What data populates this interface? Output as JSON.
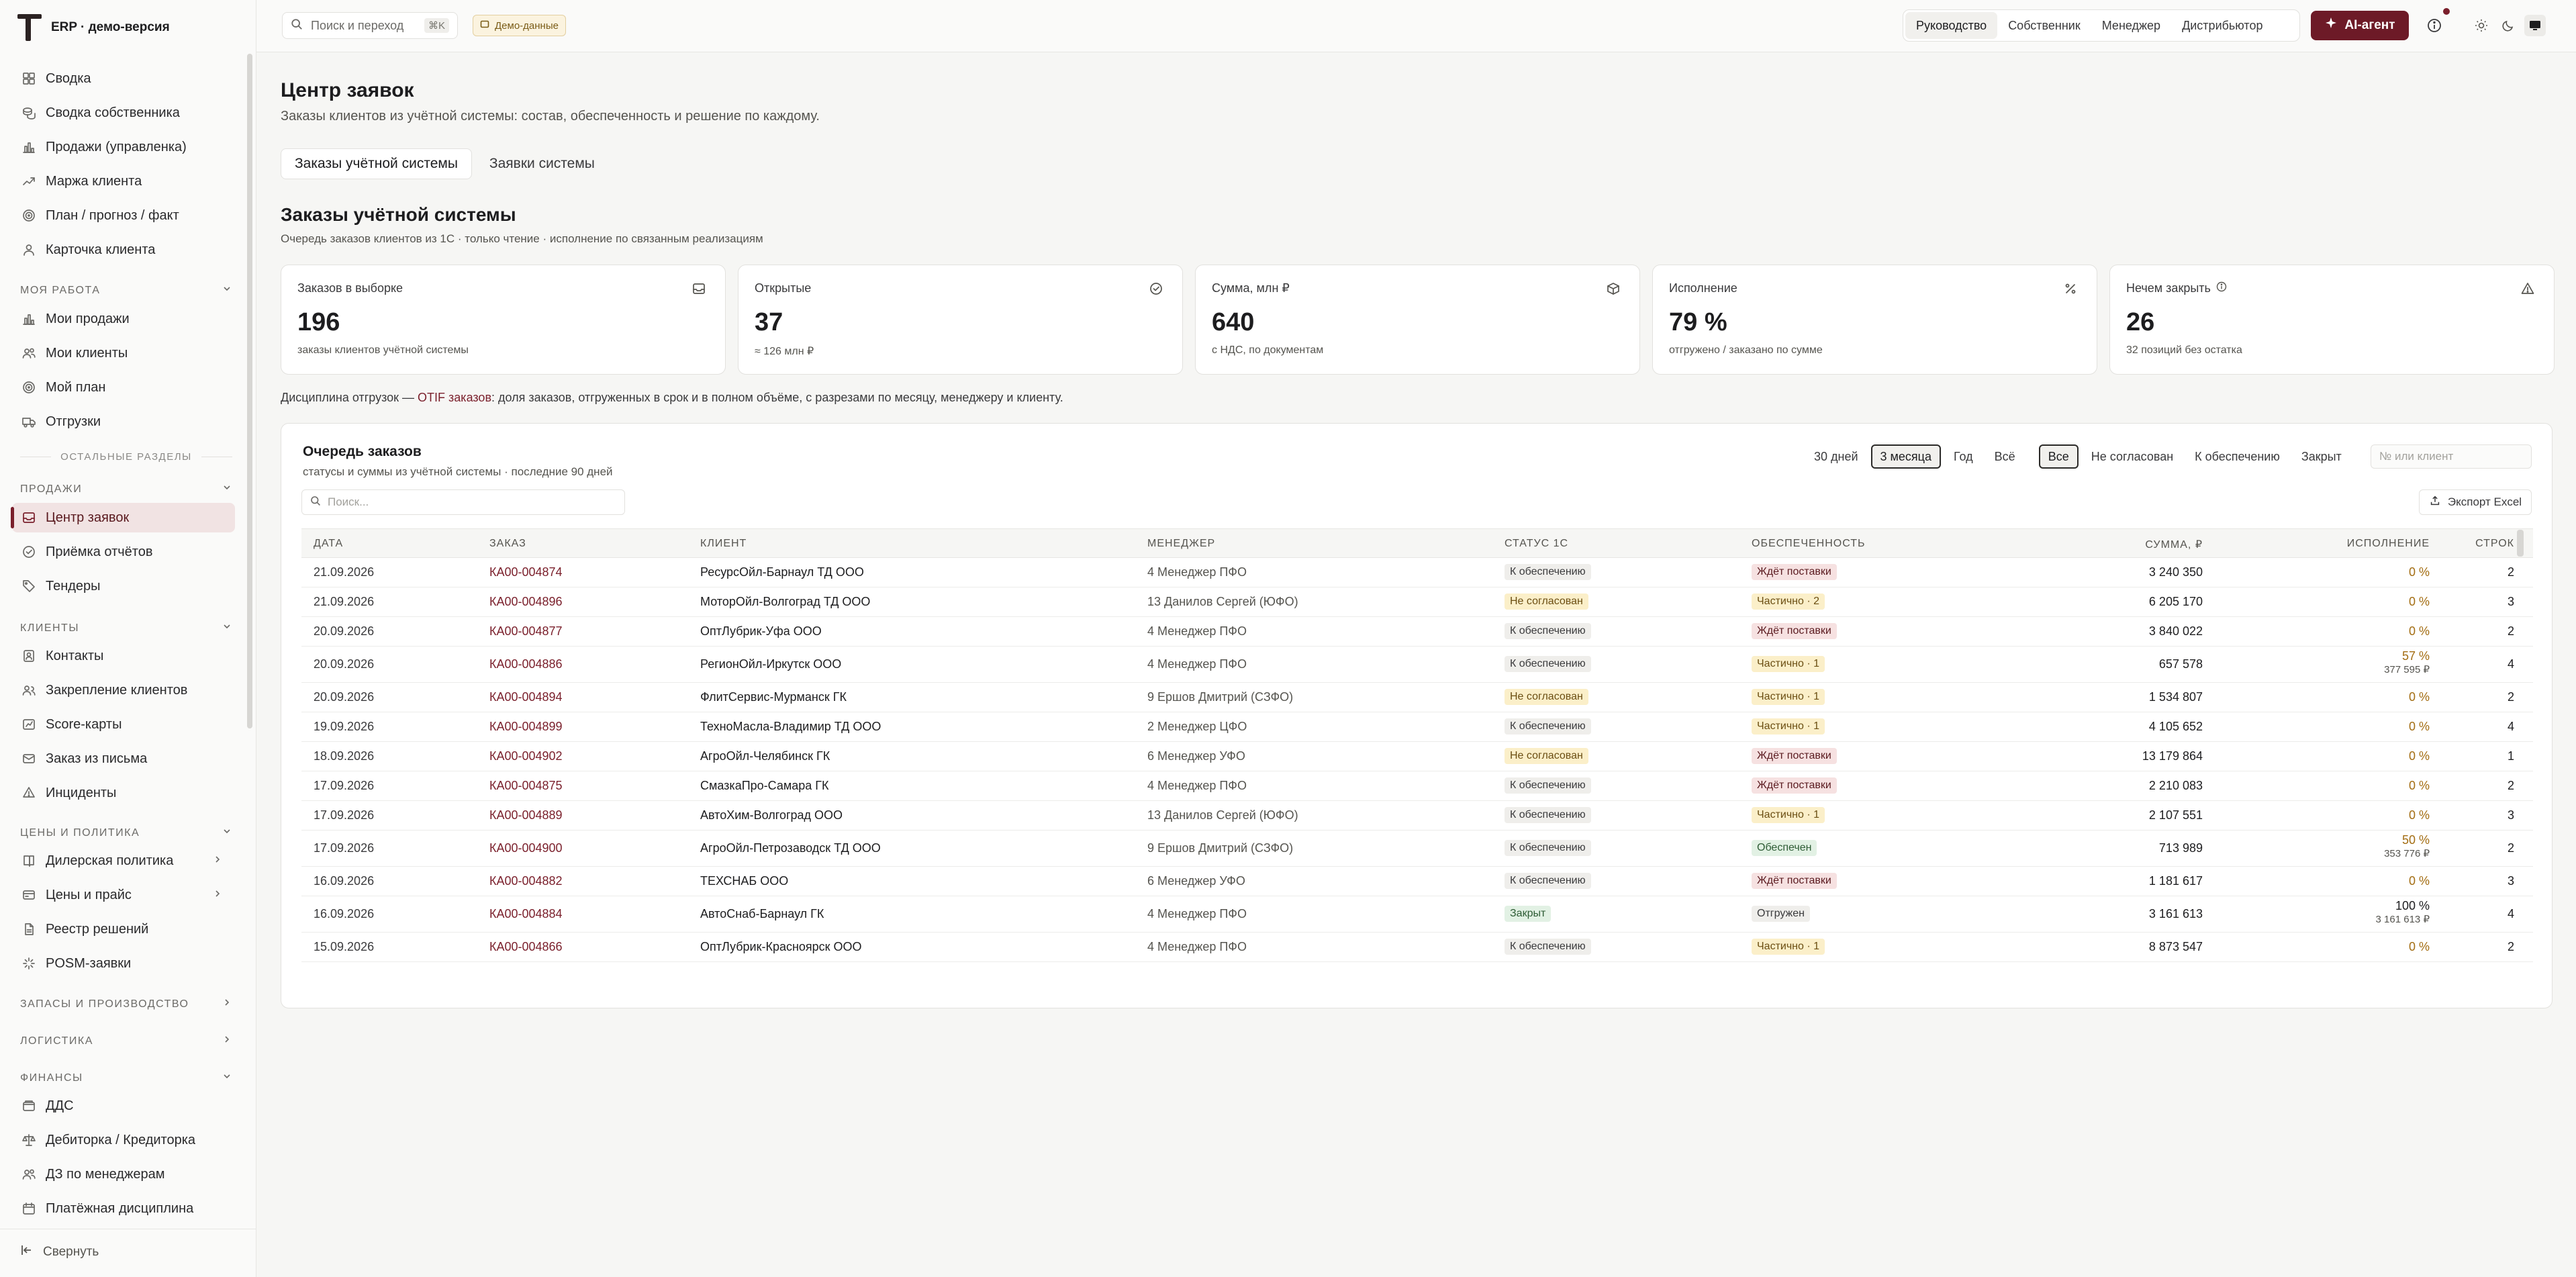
{
  "brand": {
    "name": "ERP · демо-версия"
  },
  "sidebar": {
    "top_items": [
      {
        "label": "Сводка",
        "icon": "grid-icon"
      },
      {
        "label": "Сводка собственника",
        "icon": "coins-icon"
      },
      {
        "label": "Продажи (управленка)",
        "icon": "bar-chart-icon"
      },
      {
        "label": "Маржа клиента",
        "icon": "trend-icon"
      },
      {
        "label": "План / прогноз / факт",
        "icon": "target-icon"
      },
      {
        "label": "Карточка клиента",
        "icon": "user-icon"
      }
    ],
    "section_my_work": "МОЯ РАБОТА",
    "my_work_items": [
      {
        "label": "Мои продажи",
        "icon": "bar-chart-icon"
      },
      {
        "label": "Мои клиенты",
        "icon": "users-icon"
      },
      {
        "label": "Мой план",
        "icon": "target-icon"
      },
      {
        "label": "Отгрузки",
        "icon": "truck-icon"
      }
    ],
    "other_sections": "ОСТАЛЬНЫЕ РАЗДЕЛЫ",
    "section_sales": "ПРОДАЖИ",
    "sales_items": [
      {
        "label": "Центр заявок",
        "icon": "inbox-icon"
      },
      {
        "label": "Приёмка отчётов",
        "icon": "check-circle-icon"
      },
      {
        "label": "Тендеры",
        "icon": "tag-icon"
      }
    ],
    "section_clients": "КЛИЕНТЫ",
    "clients_items": [
      {
        "label": "Контакты",
        "icon": "contacts-icon"
      },
      {
        "label": "Закрепление клиентов",
        "icon": "link-users-icon"
      },
      {
        "label": "Score-карты",
        "icon": "score-icon"
      },
      {
        "label": "Заказ из письма",
        "icon": "mail-icon"
      },
      {
        "label": "Инциденты",
        "icon": "incident-icon"
      }
    ],
    "section_prices": "ЦЕНЫ И ПОЛИТИКА",
    "prices_items": [
      {
        "label": "Дилерская политика",
        "icon": "book-icon"
      },
      {
        "label": "Цены и прайс",
        "icon": "price-icon"
      },
      {
        "label": "Реестр решений",
        "icon": "doc-icon"
      },
      {
        "label": "POSM-заявки",
        "icon": "sparkle-icon"
      }
    ],
    "section_stock": "ЗАПАСЫ И ПРОИЗВОДСТВО",
    "section_logistics": "ЛОГИСТИКА",
    "section_finance": "ФИНАНСЫ",
    "finance_items": [
      {
        "label": "ДДС",
        "icon": "wallet-icon"
      },
      {
        "label": "Дебиторка / Кредиторка",
        "icon": "scales-icon"
      },
      {
        "label": "ДЗ по менеджерам",
        "icon": "users-icon"
      },
      {
        "label": "Платёжная дисциплина",
        "icon": "calendar-icon"
      }
    ],
    "collapse_label": "Свернуть"
  },
  "topbar": {
    "search_placeholder": "Поиск и переход",
    "search_kbd": "⌘K",
    "demo_badge": "Демо-данные",
    "roles": [
      "Руководство",
      "Собственник",
      "Менеджер",
      "Дистрибьютор"
    ],
    "active_role": "Руководство",
    "ai_label": "AI-агент"
  },
  "page": {
    "title": "Центр заявок",
    "subtitle": "Заказы клиентов из учётной системы: состав, обеспеченность и решение по каждому.",
    "tabs": [
      "Заказы учётной системы",
      "Заявки системы"
    ],
    "section_title": "Заказы учётной системы",
    "section_sub": "Очередь заказов клиентов из 1С · только чтение · исполнение по связанным реализациям"
  },
  "kpis": [
    {
      "label": "Заказов в выборке",
      "value": "196",
      "note": "заказы клиентов учётной системы",
      "icon": "inbox-icon"
    },
    {
      "label": "Открытые",
      "value": "37",
      "note": "≈ 126 млн ₽",
      "icon": "check-circle-icon"
    },
    {
      "label": "Сумма, млн ₽",
      "value": "640",
      "note": "с НДС, по документам",
      "icon": "box-icon"
    },
    {
      "label": "Исполнение",
      "value": "79 %",
      "note": "отгружено / заказано по сумме",
      "icon": "percent-icon"
    },
    {
      "label": "Нечем закрыть",
      "value": "26",
      "note": "32 позиций без остатка",
      "icon": "warning-icon"
    }
  ],
  "otif": {
    "prefix": "Дисциплина отгрузок — ",
    "link": "OTIF заказов",
    "suffix": ": доля заказов, отгруженных в срок и в полном объёме, с разрезами по месяцу, менеджеру и клиенту."
  },
  "queue": {
    "title": "Очередь заказов",
    "subtitle": "статусы и суммы из учётной системы · последние 90 дней",
    "period_filters": [
      "30 дней",
      "3 месяца",
      "Год",
      "Всё"
    ],
    "active_period": "3 месяца",
    "status_filters": [
      "Все",
      "Не согласован",
      "К обеспечению",
      "Закрыт"
    ],
    "active_status": "Все",
    "number_placeholder": "№ или клиент",
    "search_placeholder": "Поиск...",
    "export_label": "Экспорт Excel",
    "columns": [
      "ДАТА",
      "ЗАКАЗ",
      "КЛИЕНТ",
      "МЕНЕДЖЕР",
      "СТАТУС 1С",
      "ОБЕСПЕЧЕННОСТЬ",
      "СУММА, ₽",
      "ИСПОЛНЕНИЕ",
      "СТРОК"
    ],
    "rows": [
      {
        "date": "21.09.2026",
        "order": "КА00-004874",
        "client": "РесурсОйл-Барнаул ТД ООО",
        "manager": "4 Менеджер ПФО",
        "status": "К обеспечению",
        "status_kind": "gray",
        "supply": "Ждёт поставки",
        "supply_kind": "pink",
        "sum": "3 240 350",
        "exec": "0 %",
        "exec_sub": "",
        "lines": "2"
      },
      {
        "date": "21.09.2026",
        "order": "КА00-004896",
        "client": "МоторОйл-Волгоград ТД ООО",
        "manager": "13 Данилов Сергей (ЮФО)",
        "status": "Не согласован",
        "status_kind": "yellow",
        "supply": "Частично · 2",
        "supply_kind": "yellow",
        "sum": "6 205 170",
        "exec": "0 %",
        "exec_sub": "",
        "lines": "3"
      },
      {
        "date": "20.09.2026",
        "order": "КА00-004877",
        "client": "ОптЛубрик-Уфа ООО",
        "manager": "4 Менеджер ПФО",
        "status": "К обеспечению",
        "status_kind": "gray",
        "supply": "Ждёт поставки",
        "supply_kind": "pink",
        "sum": "3 840 022",
        "exec": "0 %",
        "exec_sub": "",
        "lines": "2"
      },
      {
        "date": "20.09.2026",
        "order": "КА00-004886",
        "client": "РегионОйл-Иркутск ООО",
        "manager": "4 Менеджер ПФО",
        "status": "К обеспечению",
        "status_kind": "gray",
        "supply": "Частично · 1",
        "supply_kind": "yellow",
        "sum": "657 578",
        "exec": "57 %",
        "exec_sub": "377 595 ₽",
        "lines": "4"
      },
      {
        "date": "20.09.2026",
        "order": "КА00-004894",
        "client": "ФлитСервис-Мурманск ГК",
        "manager": "9 Ершов Дмитрий (СЗФО)",
        "status": "Не согласован",
        "status_kind": "yellow",
        "supply": "Частично · 1",
        "supply_kind": "yellow",
        "sum": "1 534 807",
        "exec": "0 %",
        "exec_sub": "",
        "lines": "2"
      },
      {
        "date": "19.09.2026",
        "order": "КА00-004899",
        "client": "ТехноМасла-Владимир ТД ООО",
        "manager": "2 Менеджер ЦФО",
        "status": "К обеспечению",
        "status_kind": "gray",
        "supply": "Частично · 1",
        "supply_kind": "yellow",
        "sum": "4 105 652",
        "exec": "0 %",
        "exec_sub": "",
        "lines": "4"
      },
      {
        "date": "18.09.2026",
        "order": "КА00-004902",
        "client": "АгроОйл-Челябинск ГК",
        "manager": "6 Менеджер УФО",
        "status": "Не согласован",
        "status_kind": "yellow",
        "supply": "Ждёт поставки",
        "supply_kind": "pink",
        "sum": "13 179 864",
        "exec": "0 %",
        "exec_sub": "",
        "lines": "1"
      },
      {
        "date": "17.09.2026",
        "order": "КА00-004875",
        "client": "СмазкаПро-Самара ГК",
        "manager": "4 Менеджер ПФО",
        "status": "К обеспечению",
        "status_kind": "gray",
        "supply": "Ждёт поставки",
        "supply_kind": "pink",
        "sum": "2 210 083",
        "exec": "0 %",
        "exec_sub": "",
        "lines": "2"
      },
      {
        "date": "17.09.2026",
        "order": "КА00-004889",
        "client": "АвтоХим-Волгоград ООО",
        "manager": "13 Данилов Сергей (ЮФО)",
        "status": "К обеспечению",
        "status_kind": "gray",
        "supply": "Частично · 1",
        "supply_kind": "yellow",
        "sum": "2 107 551",
        "exec": "0 %",
        "exec_sub": "",
        "lines": "3"
      },
      {
        "date": "17.09.2026",
        "order": "КА00-004900",
        "client": "АгроОйл-Петрозаводск ТД ООО",
        "manager": "9 Ершов Дмитрий (СЗФО)",
        "status": "К обеспечению",
        "status_kind": "gray",
        "supply": "Обеспечен",
        "supply_kind": "green",
        "sum": "713 989",
        "exec": "50 %",
        "exec_sub": "353 776 ₽",
        "lines": "2"
      },
      {
        "date": "16.09.2026",
        "order": "КА00-004882",
        "client": "ТЕХСНАБ ООО",
        "manager": "6 Менеджер УФО",
        "status": "К обеспечению",
        "status_kind": "gray",
        "supply": "Ждёт поставки",
        "supply_kind": "pink",
        "sum": "1 181 617",
        "exec": "0 %",
        "exec_sub": "",
        "lines": "3"
      },
      {
        "date": "16.09.2026",
        "order": "КА00-004884",
        "client": "АвтоСнаб-Барнаул ГК",
        "manager": "4 Менеджер ПФО",
        "status": "Закрыт",
        "status_kind": "green",
        "supply": "Отгружен",
        "supply_kind": "gray",
        "sum": "3 161 613",
        "exec": "100 %",
        "exec_sub": "3 161 613 ₽",
        "lines": "4"
      },
      {
        "date": "15.09.2026",
        "order": "КА00-004866",
        "client": "ОптЛубрик-Красноярск ООО",
        "manager": "4 Менеджер ПФО",
        "status": "К обеспечению",
        "status_kind": "gray",
        "supply": "Частично · 1",
        "supply_kind": "yellow",
        "sum": "8 873 547",
        "exec": "0 %",
        "exec_sub": "",
        "lines": "2"
      }
    ]
  }
}
